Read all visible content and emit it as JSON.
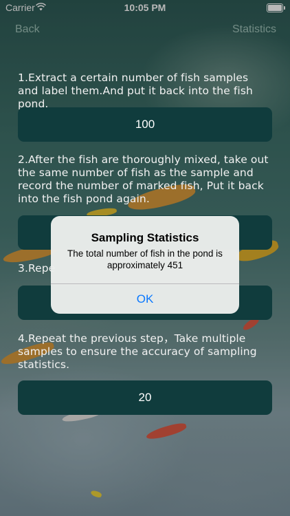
{
  "status_bar": {
    "carrier": "Carrier",
    "time": "10:05 PM"
  },
  "nav": {
    "back": "Back",
    "statistics": "Statistics"
  },
  "steps": [
    {
      "text": "1.Extract a certain number of fish samples and label them.And put it back into the fish pond.",
      "value": "100"
    },
    {
      "text": "2.After the fish are thoroughly mixed, take out the same number of fish as the sample and record the number of marked fish, Put it back into the fish pond again.",
      "value": ""
    },
    {
      "text": "3.Repe",
      "value": ""
    },
    {
      "text": "4.Repeat the previous step，Take multiple samples to ensure the accuracy of sampling statistics.",
      "value": "20"
    }
  ],
  "alert": {
    "title": "Sampling Statistics",
    "message": "The total number of fish in the pond is approximately 451",
    "ok": "OK"
  },
  "colors": {
    "field_bg": "#103c3d",
    "accent": "#0a78fe"
  }
}
